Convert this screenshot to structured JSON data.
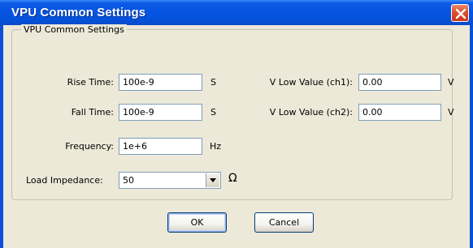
{
  "window": {
    "title": "VPU Common Settings"
  },
  "group": {
    "title": "VPU Common Settings"
  },
  "fields": {
    "rise_time": {
      "label": "Rise Time:",
      "value": "100e-9",
      "unit": "S"
    },
    "fall_time": {
      "label": "Fall Time:",
      "value": "100e-9",
      "unit": "S"
    },
    "frequency": {
      "label": "Frequency:",
      "value": "1e+6",
      "unit": "Hz"
    },
    "v_low_ch1": {
      "label": "V Low Value (ch1):",
      "value": "0.00",
      "unit": "V"
    },
    "v_low_ch2": {
      "label": "V Low Value (ch2):",
      "value": "0.00",
      "unit": "V"
    },
    "load_impedance": {
      "label": "Load Impedance:",
      "value": "50",
      "unit": "Ω"
    }
  },
  "buttons": {
    "ok": "OK",
    "cancel": "Cancel"
  },
  "icons": {
    "close": "close-icon",
    "dropdown": "dropdown-arrow-icon"
  },
  "colors": {
    "titlebar": "#0655e2",
    "client": "#ece9d8",
    "close": "#dd4f2c"
  }
}
